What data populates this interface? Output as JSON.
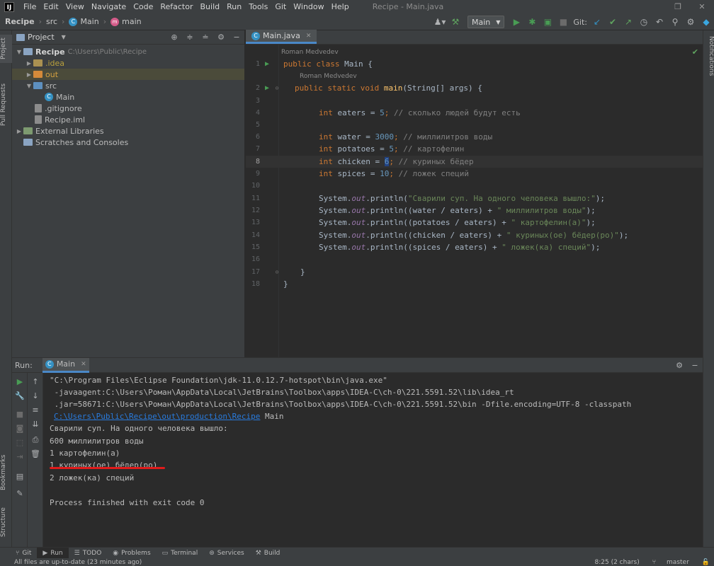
{
  "menubar": {
    "logo": "IJ",
    "items": [
      "File",
      "Edit",
      "View",
      "Navigate",
      "Code",
      "Refactor",
      "Build",
      "Run",
      "Tools",
      "Git",
      "Window",
      "Help"
    ],
    "window_title": "Recipe - Main.java"
  },
  "navbar": {
    "crumbs": [
      "Recipe",
      "src",
      "Main",
      "main"
    ]
  },
  "toolbar": {
    "run_config": "Main",
    "git_label": "Git:"
  },
  "left_stripe": {
    "project": "Project",
    "pull_requests": "Pull Requests",
    "bookmarks": "Bookmarks",
    "structure": "Structure"
  },
  "right_stripe": {
    "notifications": "Notifications"
  },
  "project_panel": {
    "title": "Project",
    "tree": [
      {
        "label": "Recipe",
        "hint": "C:\\Users\\Public\\Recipe",
        "bold": true
      },
      {
        "label": ".idea"
      },
      {
        "label": "out"
      },
      {
        "label": "src"
      },
      {
        "label": "Main"
      },
      {
        "label": ".gitignore"
      },
      {
        "label": "Recipe.iml"
      },
      {
        "label": "External Libraries"
      },
      {
        "label": "Scratches and Consoles"
      }
    ]
  },
  "editor": {
    "tab": "Main.java",
    "author1": "Roman Medvedev",
    "author2": "Roman Medvedev",
    "line_numbers": [
      "1",
      "2",
      "3",
      "4",
      "5",
      "6",
      "7",
      "8",
      "9",
      "10",
      "11",
      "12",
      "13",
      "14",
      "15",
      "16",
      "17",
      "18"
    ],
    "code": {
      "l1": {
        "kw": "public class",
        "rest": " Main {"
      },
      "l2": {
        "kw": "public static void",
        "name": " main",
        "rest": "(String[] args) {"
      },
      "l4": {
        "kw": "int",
        "name": " eaters = ",
        "num": "5",
        "semi": ";",
        "cm": " // сколько людей будут есть"
      },
      "l6": {
        "kw": "int",
        "name": " water = ",
        "num": "3000",
        "semi": ";",
        "cm": " // миллилитров воды"
      },
      "l7": {
        "kw": "int",
        "name": " potatoes = ",
        "num": "5",
        "semi": ";",
        "cm": " // картофелин"
      },
      "l8": {
        "kw": "int",
        "name": " chicken = ",
        "num": "6",
        "semi": ";",
        "cm": " // куриных бёдер"
      },
      "l9": {
        "kw": "int",
        "name": " spices = ",
        "num": "10",
        "semi": ";",
        "cm": " // ложек специй"
      },
      "l11": {
        "pre": "System.",
        "fld": "out",
        "mid": ".println(",
        "str": "\"Сварили суп. На одного человека вышло:\"",
        "end": ");"
      },
      "l12": {
        "pre": "System.",
        "fld": "out",
        "mid": ".println((water / eaters) + ",
        "str": "\" миллилитров воды\"",
        "end": ");"
      },
      "l13": {
        "pre": "System.",
        "fld": "out",
        "mid": ".println((potatoes / eaters) + ",
        "str": "\" картофелин(а)\"",
        "end": ");"
      },
      "l14": {
        "pre": "System.",
        "fld": "out",
        "mid": ".println((chicken / eaters) + ",
        "str": "\" куриных(ое) бёдер(ро)\"",
        "end": ");"
      },
      "l15": {
        "pre": "System.",
        "fld": "out",
        "mid": ".println((spices / eaters) + ",
        "str": "\" ложек(ка) специй\"",
        "end": ");"
      },
      "l17": "}",
      "l18": "}"
    }
  },
  "run_panel": {
    "label": "Run:",
    "tab": "Main",
    "console": {
      "l1": "\"C:\\Program Files\\Eclipse Foundation\\jdk-11.0.12.7-hotspot\\bin\\java.exe\"",
      "l2": " -javaagent:C:\\Users\\Роман\\AppData\\Local\\JetBrains\\Toolbox\\apps\\IDEA-C\\ch-0\\221.5591.52\\lib\\idea_rt",
      "l3": " .jar=58671:C:\\Users\\Роман\\AppData\\Local\\JetBrains\\Toolbox\\apps\\IDEA-C\\ch-0\\221.5591.52\\bin -Dfile.encoding=UTF-8 -classpath",
      "l4_link": "C:\\Users\\Public\\Recipe\\out\\production\\Recipe",
      "l4_rest": " Main",
      "l5": "Сварили суп. На одного человека вышло:",
      "l6": "600 миллилитров воды",
      "l7": "1 картофелин(а)",
      "l8": "1 куриных(ое) бёдер(ро)",
      "l9": "2 ложек(ка) специй",
      "l11": "Process finished with exit code 0"
    }
  },
  "tool_strip": {
    "git": "Git",
    "run": "Run",
    "todo": "TODO",
    "problems": "Problems",
    "terminal": "Terminal",
    "services": "Services",
    "build": "Build"
  },
  "status_bar": {
    "message": "All files are up-to-date (23 minutes ago)",
    "position": "8:25 (2 chars)",
    "branch": "master"
  },
  "colors": {
    "accent": "#4a88c7",
    "underline": "#e01b1b",
    "keyword": "#cc7832",
    "string": "#6a8759",
    "number": "#6897bb"
  }
}
